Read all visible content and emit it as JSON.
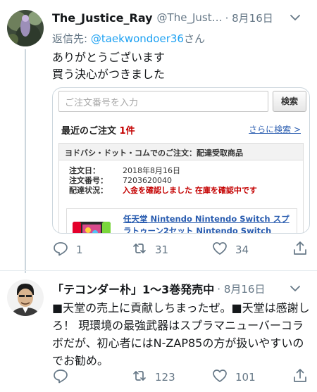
{
  "tweets": [
    {
      "name": "The_Justice_Ray",
      "handle": "@The_Just…",
      "time": "· 8月16日",
      "reply_to_prefix": "返信先: ",
      "reply_to_handle": "@taekwondoer36",
      "reply_to_suffix": "さん",
      "text_lines": [
        "ありがとうございます",
        "買う決心がつきました"
      ],
      "card": {
        "search_placeholder": "ご注文番号を入力",
        "search_button": "検索",
        "order_title": "最近のご注文",
        "order_count": "1件",
        "more_link": "さらに検索 >",
        "order_header": "ヨドバシ・ドット・コムでのご注文：配達受取商品",
        "order_date_label": "注文日：",
        "order_date": "2018年8月16日",
        "order_number_label": "注文番号：",
        "order_number": "7203620040",
        "delivery_label": "配達状況：",
        "delivery_status": "入金を確認しました 在庫を確認中です",
        "product_name": "任天堂 Nintendo Nintendo Switch スプラトゥーン2セット Nintendo Switch Online 個人"
      },
      "counts": {
        "replies": "1",
        "retweets": "31",
        "likes": "34"
      },
      "icons": [
        "reply-icon",
        "retweet-icon",
        "heart-icon",
        "share-icon"
      ]
    },
    {
      "name": "「テコンダー朴」1〜3巻発売中",
      "time": "· 8月16日",
      "text": "■天堂の売上に貢献しちまったぜ。■天堂は感謝しろ！ 現環境の最強武器はスプラマニューバーコラボだが、初心者にはN-ZAP85の方が扱いやすいのでお勧め。",
      "counts": {
        "replies": "",
        "retweets": "123",
        "likes": "101"
      }
    }
  ],
  "colors": {
    "secondary_text": "#657786",
    "link": "#1da1f2",
    "order_red": "#c40000",
    "order_link": "#2a5db0"
  }
}
